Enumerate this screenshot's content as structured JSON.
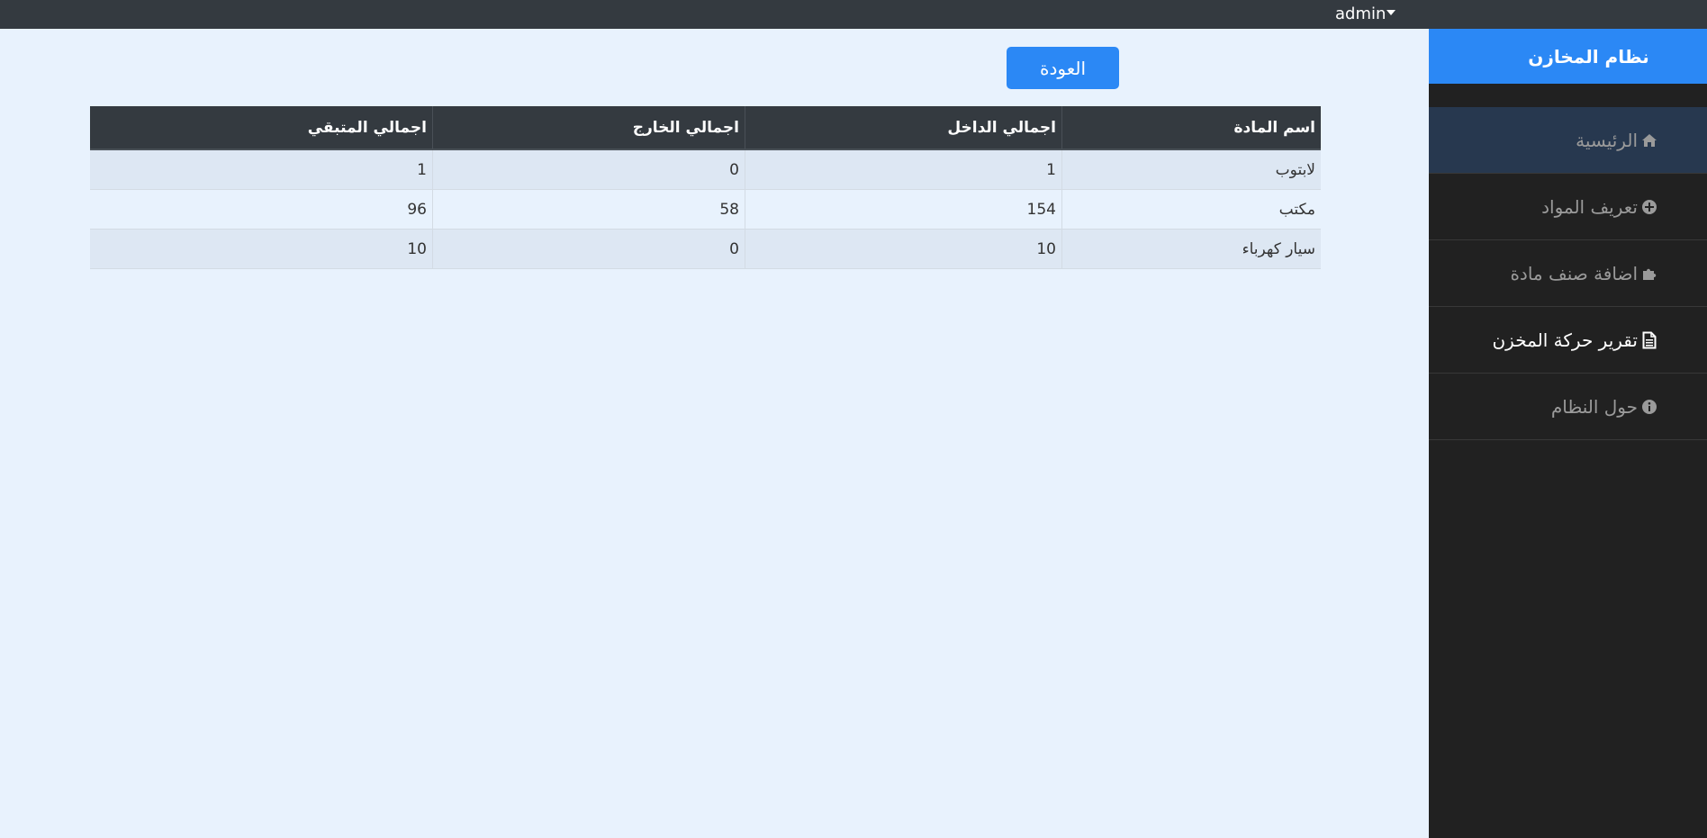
{
  "topbar": {
    "user": "admin"
  },
  "sidebar": {
    "brand": "نظام المخازن",
    "items": [
      {
        "label": "الرئيسية",
        "icon": "home-icon"
      },
      {
        "label": "تعريف المواد",
        "icon": "plus-circle-icon"
      },
      {
        "label": "اضافة صنف مادة",
        "icon": "puzzle-icon"
      },
      {
        "label": "تقرير حركة المخزن",
        "icon": "file-text-icon"
      },
      {
        "label": "حول النظام",
        "icon": "info-circle-icon"
      }
    ]
  },
  "main": {
    "back_label": "العودة",
    "table": {
      "headers": [
        "اسم المادة",
        "اجمالي الداخل",
        "اجمالي الخارج",
        "اجمالي المتبقي"
      ],
      "rows": [
        [
          "لابتوب",
          "1",
          "0",
          "1"
        ],
        [
          "مكتب",
          "154",
          "58",
          "96"
        ],
        [
          "سيار كهرباء",
          "10",
          "0",
          "10"
        ]
      ]
    }
  },
  "colors": {
    "accent": "#2b88f5",
    "topbar": "#343a40",
    "sidebar": "#212121",
    "page_bg": "#e8f2fd"
  }
}
